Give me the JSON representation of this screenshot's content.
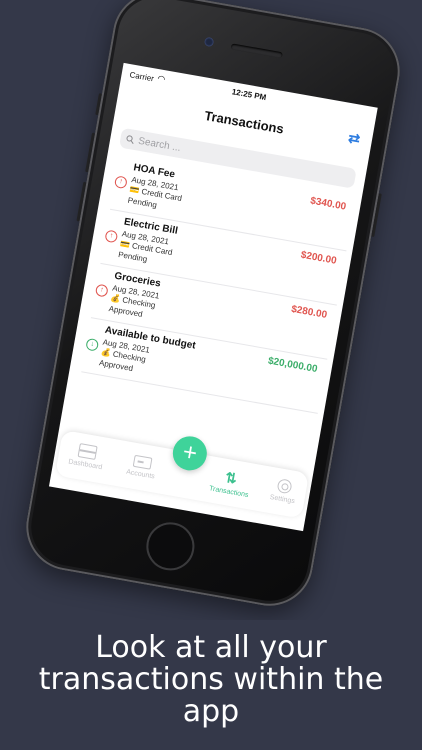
{
  "status_bar": {
    "carrier": "Carrier",
    "time": "12:25 PM"
  },
  "header": {
    "title": "Transactions",
    "sync_icon": "sync-arrows-icon"
  },
  "search": {
    "placeholder": "Search ..."
  },
  "transactions": [
    {
      "name": "HOA Fee",
      "date": "Aug 28, 2021",
      "account_icon": "credit-card-icon",
      "account": "Credit Card",
      "status": "Pending",
      "amount": "$340.00",
      "direction": "outflow"
    },
    {
      "name": "Electric Bill",
      "date": "Aug 28, 2021",
      "account_icon": "credit-card-icon",
      "account": "Credit Card",
      "status": "Pending",
      "amount": "$200.00",
      "direction": "outflow"
    },
    {
      "name": "Groceries",
      "date": "Aug 28, 2021",
      "account_icon": "money-bag-icon",
      "account": "Checking",
      "status": "Approved",
      "amount": "$280.00",
      "direction": "outflow"
    },
    {
      "name": "Available to budget",
      "date": "Aug 28, 2021",
      "account_icon": "money-bag-icon",
      "account": "Checking",
      "status": "Approved",
      "amount": "$20,000.00",
      "direction": "inflow"
    }
  ],
  "tab_bar": {
    "items": [
      {
        "label": "Dashboard",
        "icon": "dashboard-icon",
        "active": false
      },
      {
        "label": "Accounts",
        "icon": "accounts-icon",
        "active": false
      },
      {
        "label": "Transactions",
        "icon": "transactions-icon",
        "active": true
      },
      {
        "label": "Settings",
        "icon": "settings-icon",
        "active": false
      }
    ],
    "add_button_icon": "plus-icon"
  },
  "colors": {
    "background": "#343849",
    "accent_green": "#3fd39a",
    "outflow_red": "#e0554f",
    "inflow_green": "#3cae6a",
    "link_blue": "#2e7de0"
  },
  "caption": {
    "lines": [
      "Look at all your",
      "transactions within the",
      "app"
    ]
  }
}
